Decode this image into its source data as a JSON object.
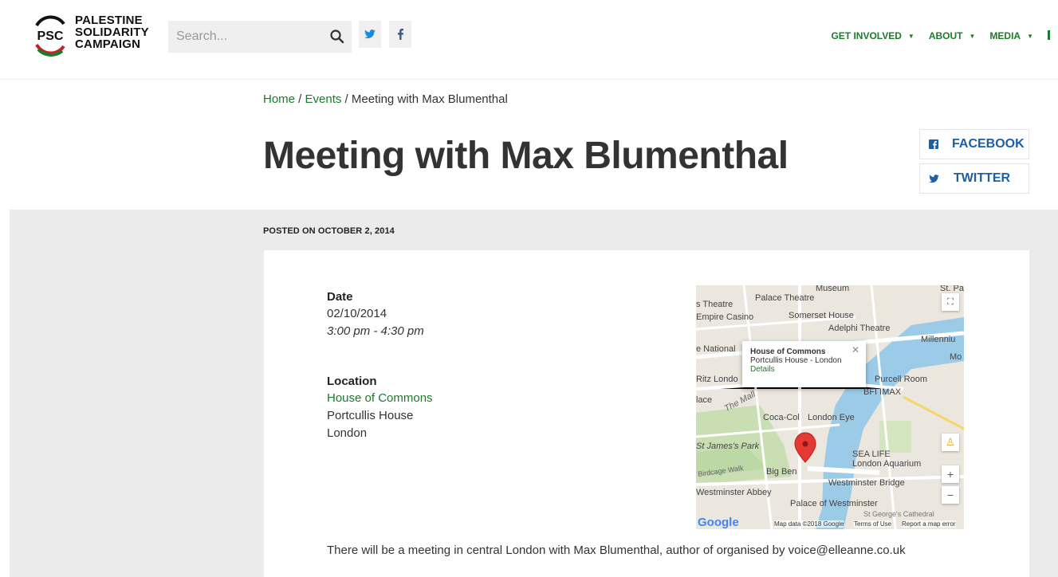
{
  "header": {
    "logo_lines": [
      "PALESTINE",
      "SOLIDARITY",
      "CAMPAIGN"
    ],
    "logo_mark_text": "PSC",
    "search_placeholder": "Search...",
    "nav": [
      {
        "label": "GET INVOLVED"
      },
      {
        "label": "ABOUT"
      },
      {
        "label": "MEDIA"
      }
    ],
    "colors": {
      "accent_green": "#1d7a2a",
      "link_blue": "#1a5fa8"
    }
  },
  "breadcrumb": {
    "home": "Home",
    "sep1": " / ",
    "events": "Events",
    "sep2": " / ",
    "current": "Meeting with Max Blumenthal"
  },
  "page_title": "Meeting with Max Blumenthal",
  "share": {
    "facebook": "FACEBOOK",
    "twitter": "TWITTER"
  },
  "posted": "POSTED ON OCTOBER 2, 2014",
  "event": {
    "date_label": "Date",
    "date": "02/10/2014",
    "time": "3:00 pm - 4:30 pm",
    "location_label": "Location",
    "venue": "House of Commons",
    "address1": "Portcullis House",
    "address2": "London",
    "description": "There will be a meeting in central London with Max Blumenthal, author of organised by voice@elleanne.co.uk"
  },
  "map": {
    "popup_title": "House of Commons",
    "popup_address": "Portcullis House - London",
    "popup_link": "Details",
    "labels": [
      "Museum",
      "St. Pa",
      "s Theatre",
      "Palace Theatre",
      "Empire Casino",
      "Somerset House",
      "Adelphi Theatre",
      "e National",
      "Millenniu",
      "Mo",
      "Ritz Londo",
      "Purcell Room",
      "BFI IMAX",
      "lace",
      "The Mall",
      "Coca-Col",
      "London Eye",
      "St James's Park",
      "SEA LIFE",
      "London Aquarium",
      "Birdcage Walk",
      "Big Ben",
      "Westminster Bridge",
      "Westminster Abbey",
      "Palace of Westminster",
      "St George's Cathedral"
    ],
    "footer": {
      "google": "Google",
      "data": "Map data ©2018 Google",
      "terms": "Terms of Use",
      "report": "Report a map error"
    }
  }
}
